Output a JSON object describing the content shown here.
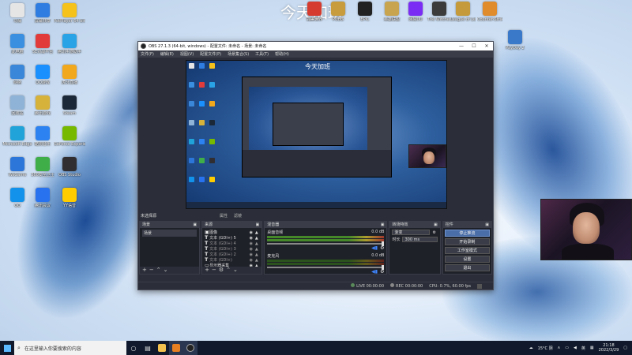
{
  "desktop": {
    "banner": "今天加班",
    "icons": [
      {
        "label": "马桶",
        "color": "#e5e5e5"
      },
      {
        "label": "屏幕共享",
        "color": "#2f7de1"
      },
      {
        "label": "PotPlayer 64 bit",
        "color": "#f5c21b"
      },
      {
        "label": "此电脑",
        "color": "#3b8fe0"
      },
      {
        "label": "5E对战平台",
        "color": "#e23b3b"
      },
      {
        "label": "腾讯手游助手",
        "color": "#2aa3e6"
      },
      {
        "label": "网络",
        "color": "#3a86d8"
      },
      {
        "label": "QQ游戏",
        "color": "#1a90ff"
      },
      {
        "label": "虎牙直播",
        "color": "#f2a81d"
      },
      {
        "label": "回收站",
        "color": "#8fb3d6"
      },
      {
        "label": "腾讯游戏",
        "color": "#d7b23a"
      },
      {
        "label": "Steam",
        "color": "#1b2838"
      },
      {
        "label": "Microsoft Edge",
        "color": "#1fa3d9"
      },
      {
        "label": "酷狗音乐",
        "color": "#2b82f0"
      },
      {
        "label": "GeForce Experience",
        "color": "#76b900"
      },
      {
        "label": "WeGame",
        "color": "#2d76d9"
      },
      {
        "label": "360安全卫士",
        "color": "#3fae49"
      },
      {
        "label": "OBS Studio",
        "color": "#302e31"
      },
      {
        "label": "QQ",
        "color": "#1292ea"
      },
      {
        "label": "腾讯会议",
        "color": "#2872f0"
      },
      {
        "label": "YY语音",
        "color": "#ffcc00"
      }
    ],
    "top_icons": [
      {
        "label": "完美世界",
        "color": "#d63b2f"
      },
      {
        "label": "PUBG",
        "color": "#c89b3c"
      },
      {
        "label": "EPIC",
        "color": "#222"
      },
      {
        "label": "英雄联盟",
        "color": "#c8a44e"
      },
      {
        "label": "网易UU",
        "color": "#7a2cf5"
      },
      {
        "label": "The Witcher",
        "color": "#3b3b3b"
      },
      {
        "label": "League of Legends",
        "color": "#c49a3a"
      },
      {
        "label": "Counter-Strike Global Off.",
        "color": "#e08b2c"
      },
      {
        "label": "PayDay 2",
        "color": "#3a78c9"
      }
    ]
  },
  "obs": {
    "title": "OBS 27.1.3 (64-bit, windows) - 配置文件: 未命名 - 场景: 未命名",
    "window_buttons": [
      "—",
      "☐",
      "✕"
    ],
    "menu": [
      "文件(F)",
      "编辑(E)",
      "视图(V)",
      "配置文件(P)",
      "场景集合(S)",
      "工具(T)",
      "帮助(H)"
    ],
    "preview_banner": "今天加班",
    "scenebar": {
      "label": "未选择源",
      "tabs": [
        "属性",
        "滤镜"
      ]
    },
    "scenes": {
      "header": "场景",
      "items": [
        "场景"
      ]
    },
    "sources": {
      "header": "来源",
      "items": [
        {
          "type": "img",
          "name": "图像",
          "dim": false
        },
        {
          "type": "T",
          "name": "文本 (GDI+) 5",
          "dim": false
        },
        {
          "type": "T",
          "name": "文本 (GDI+) 4",
          "dim": true
        },
        {
          "type": "T",
          "name": "文本 (GDI+) 3",
          "dim": true
        },
        {
          "type": "T",
          "name": "文本 (GDI+) 2",
          "dim": true
        },
        {
          "type": "T",
          "name": "文本 (GDI+)",
          "dim": true
        },
        {
          "type": "mon",
          "name": "显示器采集",
          "dim": false
        }
      ]
    },
    "mixer": {
      "header": "混音器",
      "channels": [
        {
          "name": "桌面音频",
          "db": "0.0 dB"
        },
        {
          "name": "麦克风",
          "db": "0.0 dB"
        }
      ]
    },
    "transitions": {
      "header": "转场特效",
      "type": "渐变",
      "duration_label": "时长",
      "duration": "300 ms"
    },
    "controls": {
      "header": "控件",
      "buttons": [
        "停止推流",
        "开始录制",
        "工作室模式",
        "设置",
        "退出"
      ]
    },
    "status": {
      "live_label": "LIVE",
      "live_time": "00:00:00",
      "rec_label": "REC",
      "rec_time": "00:00:00",
      "cpu": "CPU: 0.7%, 60.00 fps"
    }
  },
  "taskbar": {
    "search_placeholder": "在这里输入你要搜索的内容",
    "tray_temp": "15°C 阴",
    "lang": "英",
    "time": "21:18",
    "date": "2022/3/29"
  }
}
